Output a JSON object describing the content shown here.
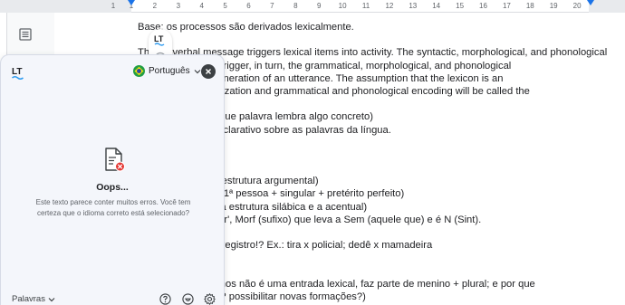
{
  "ruler": {
    "numbers": [
      "1",
      "1",
      "2",
      "3",
      "4",
      "5",
      "6",
      "7",
      "8",
      "9",
      "10",
      "11",
      "12",
      "13",
      "14",
      "15",
      "16",
      "17",
      "18",
      "19",
      "20"
    ]
  },
  "document": {
    "lines": [
      {
        "text": "Base: os processos são derivados lexicalmente.",
        "justify": false
      },
      {
        "text": "",
        "justify": false
      },
      {
        "text": "The preverbal message triggers lexical items into activity. The syntactic, morphological, and phonological",
        "justify": true
      },
      {
        "text": "                                     ivated lexical item trigger, in turn, the grammatical, morphological, and phonological",
        "justify": false
      },
      {
        "text": "                                     s underlying the generation of an utterance. The assumption that the lexicon is an",
        "justify": false
      },
      {
        "text": "                                     etween conceptualization and grammatical and phonological encoding will be called the",
        "justify": false
      },
      {
        "text": "",
        "justify": false
      },
      {
        "text": "                                     (não palavras, porque palavra lembra algo concreto)",
        "justify": false
      },
      {
        "text": "                                     e conhecimento declarativo sobre as palavras da língua.",
        "justify": false
      },
      {
        "text": "",
        "justify": false
      },
      {
        "text": "                                     a com 4 traços:",
        "justify": false
      },
      {
        "text": "",
        "justify": false
      },
      {
        "text": "                                     classe gramatical, estrutura argumental)",
        "justify": false
      },
      {
        "text": "                                     ógica (amei: raiz + 1ª pessoa + singular + pretérito perfeito)",
        "justify": false
      },
      {
        "text": "                                     gica (os fonemas, a estrutura silábica e a acentual)",
        "justify": false
      },
      {
        "text": "                                     esses traços: 'pintor', Morf (sufixo) que leva a Sem (aquele que) e é N (Sint).",
        "justify": false
      },
      {
        "text": "",
        "justify": false
      },
      {
        "text": "                                     ticos, de estilo, de registro!? Ex.: tira x policial; dedê x mamadeira",
        "justify": false
      },
      {
        "text": "",
        "justify": false
      },
      {
        "text": "",
        "justify": false
      },
      {
        "text": "                                     o de flexões; meninos não é uma entrada lexical, faz parte de menino + plural; e por que",
        "justify": false
      },
      {
        "text": "                                     ar menos espaços? possibilitar novas formações?)",
        "justify": false
      }
    ]
  },
  "panel": {
    "language": "Português",
    "title": "Oops...",
    "message": "Este texto parece conter muitos erros. Você tem certeza que o idioma correto está selecionado?",
    "footer_words": "Palavras",
    "icons": {
      "logo": "languagetool-logo",
      "flag": "brazil-flag-icon",
      "close": "close-icon",
      "help": "help-icon",
      "premium": "smile-icon",
      "settings": "gear-icon",
      "document": "document-error-icon"
    }
  },
  "colors": {
    "accent": "#1a73e8",
    "lt_blue": "#2d9bf0",
    "error_red": "#e53935",
    "panel_bg": "#f4f6fb"
  }
}
